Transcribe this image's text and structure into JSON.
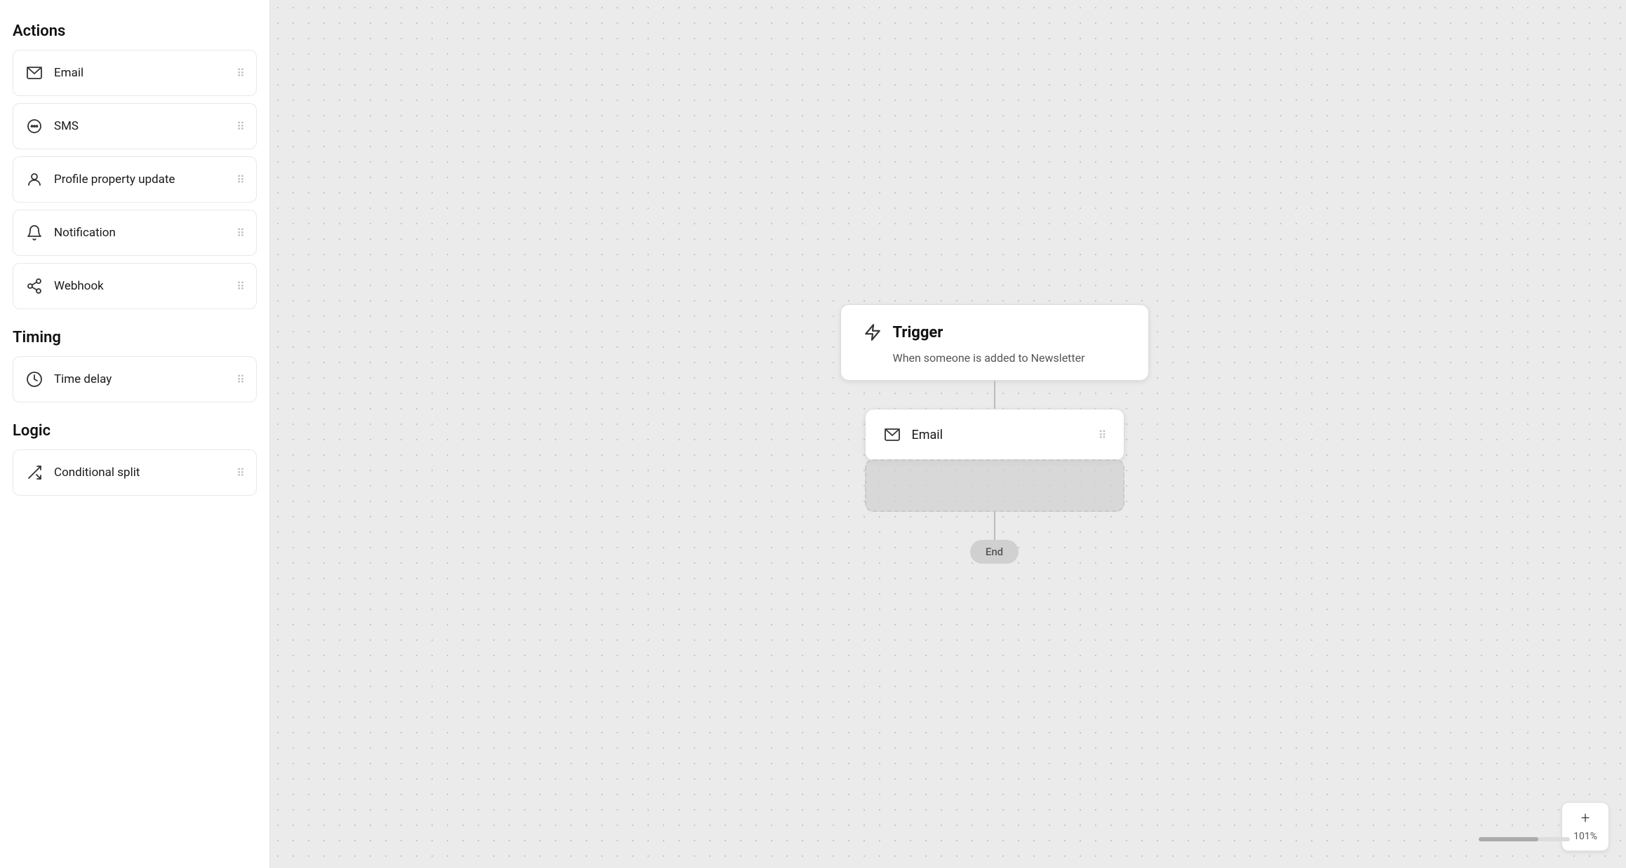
{
  "sidebar": {
    "sections": [
      {
        "title": "Actions",
        "items": [
          {
            "id": "email",
            "label": "Email",
            "icon": "mail-icon"
          },
          {
            "id": "sms",
            "label": "SMS",
            "icon": "sms-icon"
          },
          {
            "id": "profile-property-update",
            "label": "Profile property update",
            "icon": "person-icon"
          },
          {
            "id": "notification",
            "label": "Notification",
            "icon": "bell-icon"
          },
          {
            "id": "webhook",
            "label": "Webhook",
            "icon": "webhook-icon"
          }
        ]
      },
      {
        "title": "Timing",
        "items": [
          {
            "id": "time-delay",
            "label": "Time delay",
            "icon": "clock-icon"
          }
        ]
      },
      {
        "title": "Logic",
        "items": [
          {
            "id": "conditional-split",
            "label": "Conditional split",
            "icon": "split-icon"
          }
        ]
      }
    ]
  },
  "canvas": {
    "trigger": {
      "title": "Trigger",
      "description": "When someone is added to Newsletter"
    },
    "email_node": {
      "label": "Email"
    },
    "end_node": {
      "label": "End"
    }
  },
  "zoom": {
    "percent": "101%",
    "plus_label": "+",
    "minus_label": "−"
  }
}
